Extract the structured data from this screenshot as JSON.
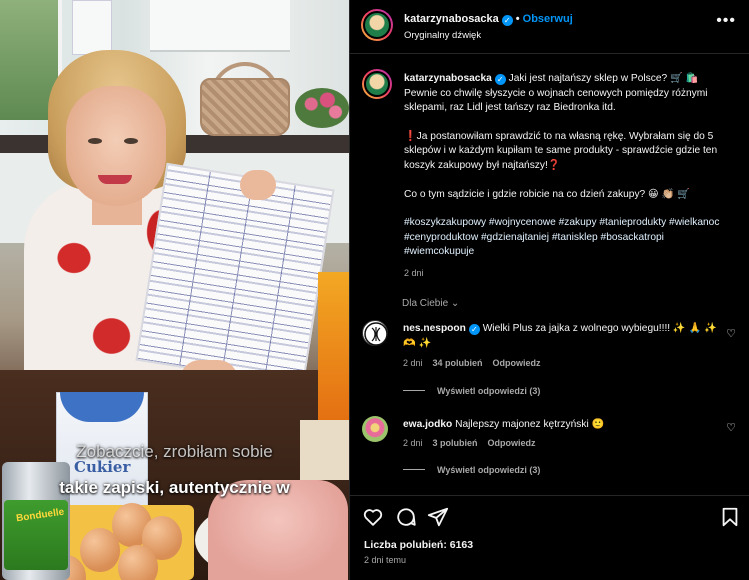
{
  "video": {
    "subtitle_top": "Zobaczcie, zrobiłam sobie",
    "subtitle_bottom": "takie zapiski, autentycznie w",
    "product_sugar": "Cukier",
    "product_can": "Bonduelle"
  },
  "header": {
    "username": "katarzynabosacka",
    "separator": "•",
    "follow_label": "Obserwuj",
    "audio_label": "Oryginalny dźwięk",
    "more_icon": "more-horizontal-icon"
  },
  "caption": {
    "username": "katarzynabosacka",
    "intro": " Jaki jest najtańszy sklep w Polsce? 🛒 🛍️ Pewnie co chwilę słyszycie o wojnach cenowych pomiędzy różnymi sklepami, raz Lidl jest tańszy raz Biedronka itd.",
    "paragraph2": "❗Ja postanowiłam sprawdzić to na własną rękę. Wybrałam się do 5 sklepów i w każdym kupiłam te same produkty - sprawdźcie gdzie ten koszyk zakupowy był najtańszy!❓",
    "paragraph3": "Co o tym sądzicie i gdzie robicie na co dzień zakupy? 😀 👏🏼 🛒",
    "hashtags": "#koszykzakupowy #wojnycenowe #zakupy #tanieprodukty #wielkanoc #cenyproduktow #gdzienajtaniej #tanisklep #bosackatropi #wiemcokupuje",
    "time": "2 dni"
  },
  "filter": {
    "label": "Dla Ciebie",
    "icon": "chevron-down-icon"
  },
  "comments": [
    {
      "username": "nes.nespoon",
      "text": "Wielki Plus za jajka z wolnego wybiegu!!!! ✨ 🙏 ✨ 🫶 ✨",
      "time": "2 dni",
      "likes": "34 polubień",
      "reply": "Odpowiedz",
      "replies": "Wyświetl odpowiedzi (3)"
    },
    {
      "username": "ewa.jodko",
      "text": "Najlepszy majonez kętrzyński 🙂",
      "time": "2 dni",
      "likes": "3 polubień",
      "reply": "Odpowiedz",
      "replies": "Wyświetl odpowiedzi (3)"
    }
  ],
  "actions": {
    "likes": "Liczba polubień: 6163",
    "ago": "2 dni temu",
    "icons": [
      "heart-icon",
      "comment-icon",
      "share-icon",
      "bookmark-icon"
    ]
  },
  "colors": {
    "accent": "#0095f6",
    "muted": "#a8a8a8",
    "background": "#000000",
    "border": "#262626"
  }
}
